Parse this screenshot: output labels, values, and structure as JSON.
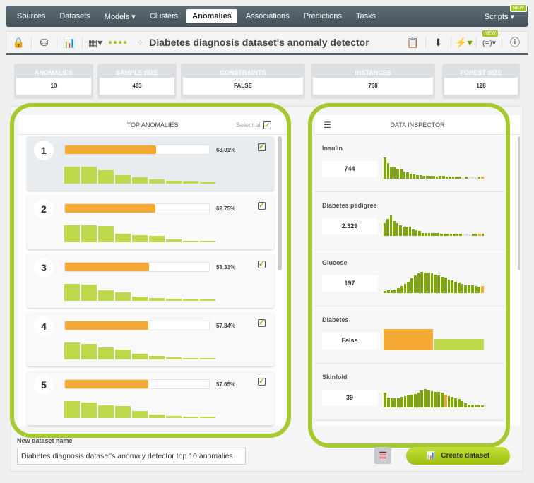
{
  "nav": {
    "items": [
      "Sources",
      "Datasets",
      "Models ▾",
      "Clusters",
      "Anomalies",
      "Associations",
      "Predictions",
      "Tasks"
    ],
    "active": "Anomalies",
    "scripts": "Scripts ▾",
    "new_badge": "NEW"
  },
  "toolbar": {
    "title": "Diabetes diagnosis dataset's anomaly detector",
    "new_badge": "NEW"
  },
  "stats": [
    {
      "label": "ANOMALIES",
      "value": "10"
    },
    {
      "label": "SAMPLE SIZE",
      "value": "483"
    },
    {
      "label": "CONSTRAINTS",
      "value": "FALSE"
    },
    {
      "label": "INSTANCES",
      "value": "768"
    },
    {
      "label": "FOREST SIZE",
      "value": "128"
    }
  ],
  "top_anomalies": {
    "title": "TOP ANOMALIES",
    "select_all": "Select all",
    "items": [
      {
        "rank": "1",
        "score": "63.01%",
        "fill": 0.63,
        "hist": [
          1,
          1,
          0.8,
          0.5,
          0.36,
          0.23,
          0.18,
          0.14,
          0.05
        ]
      },
      {
        "rank": "2",
        "score": "62.75%",
        "fill": 0.627,
        "hist": [
          1,
          1,
          0.95,
          0.5,
          0.41,
          0.36,
          0.18,
          0.09,
          0.09
        ]
      },
      {
        "rank": "3",
        "score": "58.31%",
        "fill": 0.583,
        "hist": [
          1,
          0.95,
          0.64,
          0.5,
          0.27,
          0.18,
          0.14,
          0.09,
          0.05
        ]
      },
      {
        "rank": "4",
        "score": "57.84%",
        "fill": 0.578,
        "hist": [
          1,
          0.9,
          0.7,
          0.6,
          0.35,
          0.22,
          0.14,
          0.09,
          0.05
        ]
      },
      {
        "rank": "5",
        "score": "57.65%",
        "fill": 0.576,
        "hist": [
          1,
          0.9,
          0.75,
          0.7,
          0.4,
          0.2,
          0.14,
          0.09,
          0.05
        ]
      }
    ]
  },
  "data_inspector": {
    "title": "DATA INSPECTOR",
    "fields": [
      {
        "name": "Insulin",
        "value": "744",
        "hist": [
          1,
          0.75,
          0.55,
          0.53,
          0.48,
          0.42,
          0.35,
          0.3,
          0.25,
          0.2,
          0.18,
          0.18,
          0.15,
          0.13,
          0.12,
          0.12,
          0.1,
          0.12,
          0.12,
          0.1,
          0.1,
          0.1,
          0.1,
          0.1,
          0,
          0.1,
          0,
          0,
          0,
          0.1,
          0.1
        ],
        "highlight": 30
      },
      {
        "name": "Diabetes pedigree",
        "value": "2.329",
        "hist": [
          0.6,
          0.8,
          1,
          0.7,
          0.6,
          0.5,
          0.45,
          0.42,
          0.42,
          0.3,
          0.28,
          0.22,
          0.15,
          0.15,
          0.12,
          0.12,
          0.12,
          0.12,
          0.1,
          0.1,
          0.1,
          0.1,
          0.1,
          0.1,
          0.1,
          0,
          0,
          0,
          0.1,
          0.1,
          0.1,
          0.1
        ],
        "highlight": 30
      },
      {
        "name": "Glucose",
        "value": "197",
        "hist": [
          0.1,
          0.12,
          0.14,
          0.18,
          0.25,
          0.35,
          0.45,
          0.55,
          0.7,
          0.85,
          0.95,
          1,
          0.98,
          0.98,
          0.95,
          0.88,
          0.82,
          0.78,
          0.72,
          0.65,
          0.6,
          0.52,
          0.48,
          0.42,
          0.38,
          0.36,
          0.36,
          0.32,
          0.3,
          0.32
        ],
        "highlight": 29
      },
      {
        "name": "Diabetes",
        "value": "False",
        "categorical": [
          1,
          0.52
        ],
        "highlight": 0
      },
      {
        "name": "Skinfold",
        "value": "39",
        "hist": [
          0.7,
          0.48,
          0.45,
          0.45,
          0.45,
          0.5,
          0.55,
          0.58,
          0.6,
          0.65,
          0.7,
          0.8,
          0.88,
          0.82,
          0.78,
          0.75,
          0.75,
          0.7,
          0.6,
          0.55,
          0.5,
          0.45,
          0.4,
          0.3,
          0.2,
          0.15,
          0.12,
          0.1,
          0.1,
          0.1
        ],
        "highlight": 18
      }
    ]
  },
  "footer": {
    "name_label": "New dataset name",
    "name_value": "Diabetes diagnosis dataset's anomaly detector top 10 anomalies",
    "create": "Create dataset"
  },
  "colors": {
    "accent": "#a6c830",
    "orange": "#f5a935",
    "bar_green": "#bfd94d",
    "hist_green": "#7ea80a",
    "nav": "#4e5b64"
  }
}
